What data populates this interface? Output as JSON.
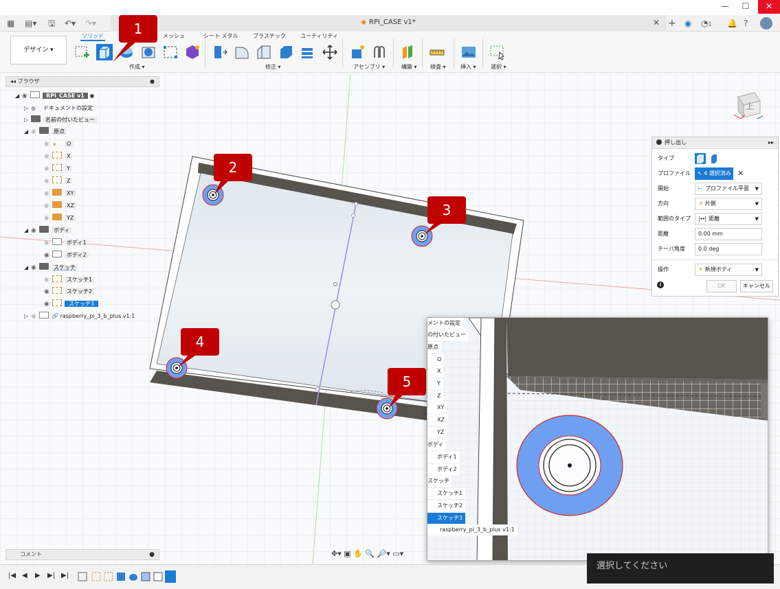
{
  "window": {
    "minimize": "—",
    "maximize": "☐",
    "close": "✕"
  },
  "tabbar": {
    "doc_title": "RPI_CASE v1*",
    "notification_count": "1"
  },
  "toolbar": {
    "design_button": "デザイン ▾",
    "workspace_tabs": [
      "ソリッド",
      "メッシュ",
      "シート メタル",
      "プラスチック",
      "ユーティリティ"
    ],
    "groups": [
      "作成 ▾",
      "修正 ▾",
      "アセンブリ ▾",
      "構築 ▾",
      "検査 ▾",
      "挿入 ▾",
      "選択 ▾"
    ]
  },
  "browser": {
    "title": "ブラウザ",
    "root": "RPI_CASE v1",
    "items": [
      {
        "label": "ドキュメントの設定"
      },
      {
        "label": "名前の付いたビュー"
      },
      {
        "label": "原点"
      },
      {
        "label": "O"
      },
      {
        "label": "X"
      },
      {
        "label": "Y"
      },
      {
        "label": "Z"
      },
      {
        "label": "XY"
      },
      {
        "label": "XZ"
      },
      {
        "label": "YZ"
      },
      {
        "label": "ボディ"
      },
      {
        "label": "ボディ1"
      },
      {
        "label": "ボディ2"
      },
      {
        "label": "スケッチ"
      },
      {
        "label": "スケッチ1"
      },
      {
        "label": "スケッチ2"
      },
      {
        "label": "スケッチ3"
      },
      {
        "label": "raspberry_pi_3_b_plus v1:1"
      }
    ]
  },
  "comments": {
    "label": "コメント"
  },
  "extrude": {
    "title": "押し出し",
    "rows": {
      "type_label": "タイプ",
      "profile_label": "プロファイル",
      "profile_value": "4 選択済み",
      "start_label": "開始",
      "start_value": "プロファイル平面",
      "direction_label": "方向",
      "direction_value": "片側",
      "extent_label": "範囲のタイプ",
      "extent_value": "距離",
      "distance_label": "距離",
      "distance_value": "0.00 mm",
      "taper_label": "テーパ角度",
      "taper_value": "0.0 deg",
      "operation_label": "操作",
      "operation_value": "新規ボディ"
    },
    "ok": "OK",
    "cancel": "キャンセル"
  },
  "viewcube": {
    "face": "上"
  },
  "callouts": [
    "1",
    "2",
    "3",
    "4",
    "5"
  ],
  "inset": {
    "items": [
      {
        "label": "メントの設定"
      },
      {
        "label": "の付いたビュー"
      },
      {
        "label": "原点"
      },
      {
        "label": "O"
      },
      {
        "label": "X"
      },
      {
        "label": "Y"
      },
      {
        "label": "Z"
      },
      {
        "label": "XY"
      },
      {
        "label": "XZ"
      },
      {
        "label": "YZ"
      },
      {
        "label": "ボディ"
      },
      {
        "label": "ボディ1"
      },
      {
        "label": "ボディ2"
      },
      {
        "label": "スケッチ"
      },
      {
        "label": "スケッチ1"
      },
      {
        "label": "スケッチ2"
      },
      {
        "label": "スケッチ3"
      },
      {
        "label": "raspberry_pi_3_b_plus v1:1"
      }
    ]
  },
  "status": {
    "select_prompt": "選択してください"
  },
  "colors": {
    "accent": "#1a7bd6",
    "callout": "#c00000",
    "selection_fill": "#6e9ff0",
    "box_wall": "#57534d"
  }
}
